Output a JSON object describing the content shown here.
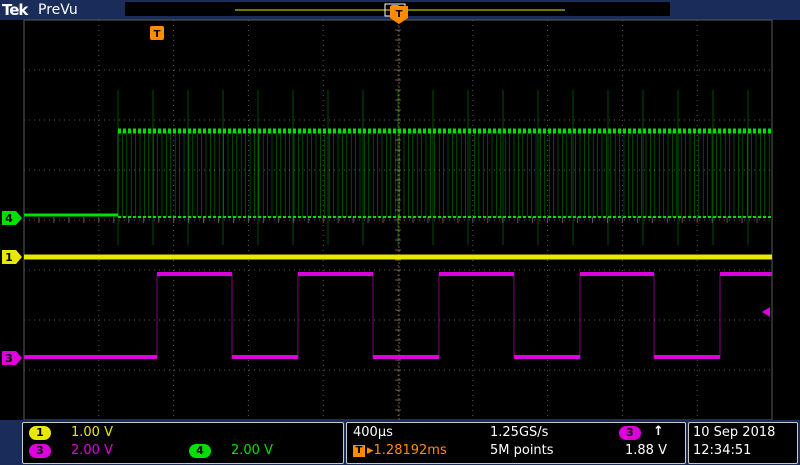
{
  "header": {
    "brand": "Tek",
    "mode": "PreVu"
  },
  "colors": {
    "ch1": "#e8e800",
    "ch3": "#dd00dd",
    "ch4": "#00e000",
    "grid": "#5a5a5a",
    "trigger": "#ff8c00",
    "panel_bg": "#1a2c5a"
  },
  "markers": {
    "trigger_pos": "T",
    "ch1": "1",
    "ch3": "3",
    "ch4": "4"
  },
  "vertical": {
    "ch1_badge": "1",
    "ch1_scale": "1.00 V",
    "ch3_badge": "3",
    "ch3_scale": "2.00 V",
    "ch4_badge": "4",
    "ch4_scale": "2.00 V"
  },
  "horizontal": {
    "timebase": "400µs",
    "sample_rate": "1.25GS/s",
    "trigger_icon": "T",
    "position": "▸1.28192ms",
    "record_length": "5M points",
    "trigger_source": "3",
    "trigger_slope": "↑",
    "trigger_level": "1.88 V"
  },
  "datetime": {
    "date": "10 Sep 2018",
    "time": "12:34:51"
  }
}
